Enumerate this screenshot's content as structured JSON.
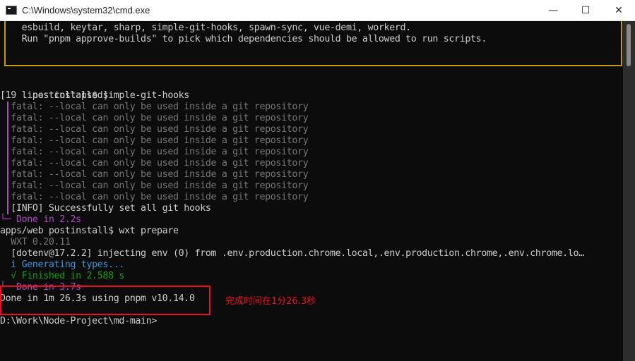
{
  "window": {
    "title": "C:\\Windows\\system32\\cmd.exe",
    "minimize": "—",
    "maximize": "☐",
    "close": "✕"
  },
  "terminal": {
    "lines": [
      "    esbuild, keytar, sharp, simple-git-hooks, spawn-sync, vue-demi, workerd.",
      "    Run \"pnpm approve-builds\" to pick which dependencies should be allowed to run scripts.",
      ". postinstall$ simple-git-hooks",
      "[19 lines collapsed]",
      "  fatal: --local can only be used inside a git repository",
      "  fatal: --local can only be used inside a git repository",
      "  fatal: --local can only be used inside a git repository",
      "  fatal: --local can only be used inside a git repository",
      "  fatal: --local can only be used inside a git repository",
      "  fatal: --local can only be used inside a git repository",
      "  fatal: --local can only be used inside a git repository",
      "  fatal: --local can only be used inside a git repository",
      "  fatal: --local can only be used inside a git repository",
      "  [INFO] Successfully set all git hooks",
      "└─ Done in 2.2s",
      "apps/web postinstall$ wxt prepare",
      "  WXT 0.20.11",
      "  [dotenv@17.2.2] injecting env (0) from .env.production.chrome.local,.env.production.chrome,.env.chrome.lo…",
      "  i Generating types...",
      "  √ Finished in 2.588 s",
      "└─ Done in 3.7s",
      "Done in 1m 26.3s using pnpm v10.14.0",
      "",
      "D:\\Work\\Node-Project\\md-main>"
    ]
  },
  "annotation": {
    "text": "完成时间在1分26.3秒"
  },
  "colors": {
    "warn_border": "#c19c00",
    "magenta": "#b148c6",
    "highlight": "#e81123"
  }
}
